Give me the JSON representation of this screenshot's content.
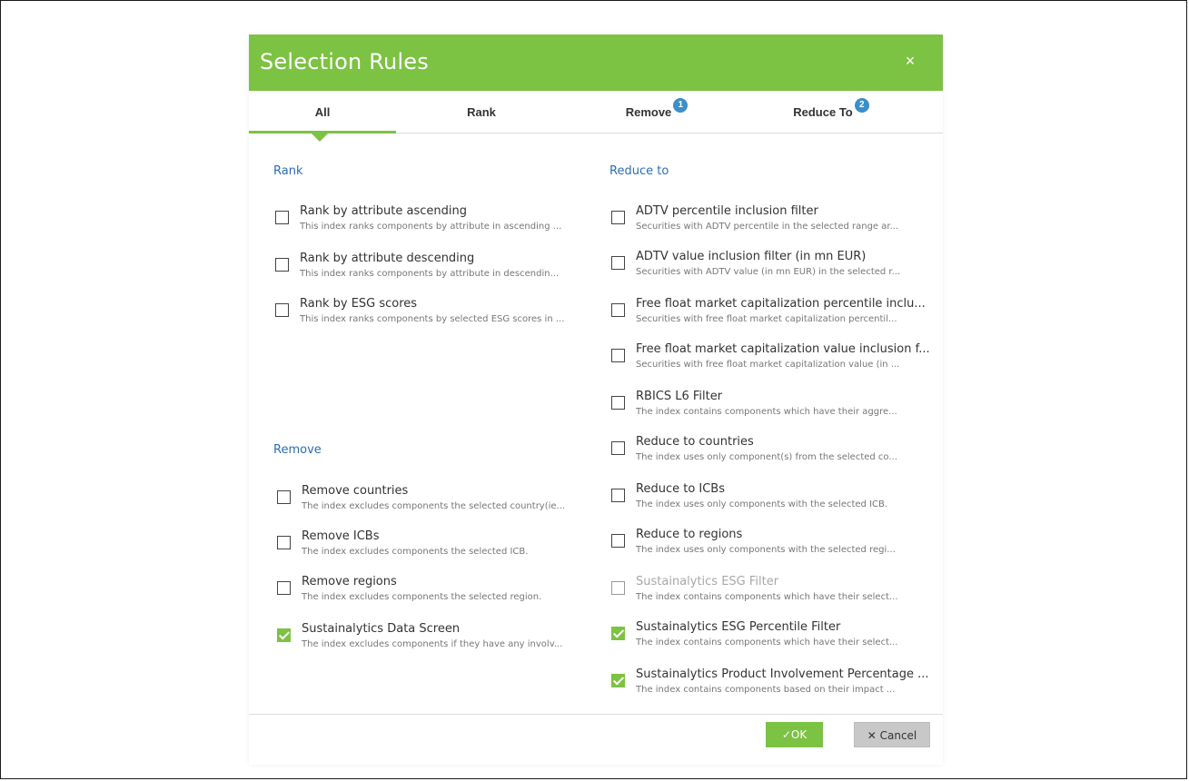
{
  "dialog": {
    "title": "Selection Rules",
    "close_icon": "×",
    "accent_color": "#7cc243",
    "link_color": "#2a6eb5"
  },
  "tabs": [
    {
      "label": "All",
      "active": true,
      "badge": null
    },
    {
      "label": "Rank",
      "active": false,
      "badge": null
    },
    {
      "label": "Remove",
      "active": false,
      "badge": "1"
    },
    {
      "label": "Reduce To",
      "active": false,
      "badge": "2"
    }
  ],
  "sections": {
    "rank": {
      "title": "Rank",
      "items": [
        {
          "name": "Rank by attribute ascending",
          "desc": "This index ranks components by attribute in ascending ...",
          "checked": false
        },
        {
          "name": "Rank by attribute descending",
          "desc": "This index ranks components by attribute in descendin...",
          "checked": false
        },
        {
          "name": "Rank by ESG scores",
          "desc": "This index ranks components by selected ESG scores in ...",
          "checked": false
        }
      ]
    },
    "remove": {
      "title": "Remove",
      "items": [
        {
          "name": "Remove countries",
          "desc": "The index excludes components the selected country(ie...",
          "checked": false
        },
        {
          "name": "Remove ICBs",
          "desc": "The index excludes components the selected ICB.",
          "checked": false
        },
        {
          "name": "Remove regions",
          "desc": "The index excludes components the selected region.",
          "checked": false
        },
        {
          "name": "Sustainalytics Data Screen",
          "desc": "The index excludes components if they have any involv...",
          "checked": true
        }
      ]
    },
    "reduce": {
      "title": "Reduce to",
      "items": [
        {
          "name": "ADTV percentile inclusion filter",
          "desc": "Securities with ADTV percentile in the selected range ar...",
          "checked": false
        },
        {
          "name": "ADTV value inclusion filter (in mn EUR)",
          "desc": "Securities with ADTV value (in mn EUR) in the selected r...",
          "checked": false
        },
        {
          "name": "Free float market capitalization percentile inclu...",
          "desc": "Securities with free float market capitalization percentil...",
          "checked": false
        },
        {
          "name": "Free float market capitalization value inclusion f...",
          "desc": "Securities with free float market capitalization value (in ...",
          "checked": false
        },
        {
          "name": "RBICS L6 Filter",
          "desc": "The index contains components which have their aggre...",
          "checked": false
        },
        {
          "name": "Reduce to countries",
          "desc": "The index uses only component(s) from the selected co...",
          "checked": false
        },
        {
          "name": "Reduce to ICBs",
          "desc": "The index uses only components with the selected ICB.",
          "checked": false
        },
        {
          "name": "Reduce to regions",
          "desc": "The index uses only components with the selected regi...",
          "checked": false
        },
        {
          "name": "Sustainalytics ESG Filter",
          "desc": "The index contains components which have their select...",
          "checked": false,
          "disabled": true
        },
        {
          "name": "Sustainalytics ESG Percentile Filter",
          "desc": "The index contains components which have their select...",
          "checked": true
        },
        {
          "name": "Sustainalytics Product Involvement Percentage ...",
          "desc": "The index contains components based on their impact ...",
          "checked": true
        }
      ]
    }
  },
  "footer": {
    "ok_label": "✓OK",
    "cancel_label": "✕ Cancel"
  }
}
